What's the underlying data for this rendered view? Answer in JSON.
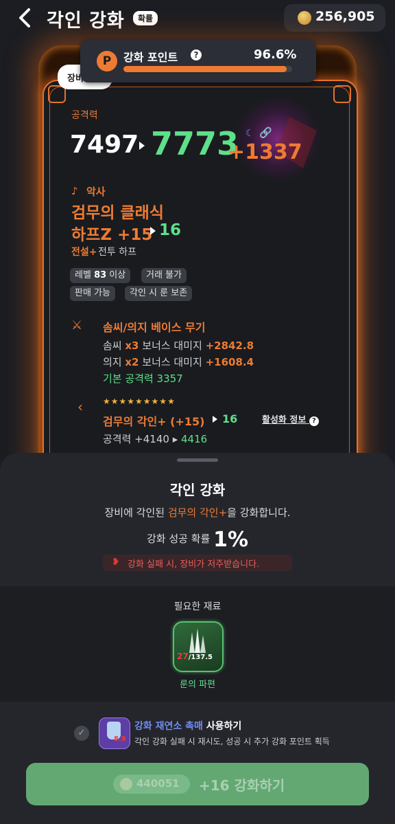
{
  "header": {
    "title": "각인 강화",
    "probability_badge": "확률",
    "coin_balance": "256,905",
    "icons": {
      "back": "back-chevron-icon",
      "coin": "coin-icon"
    }
  },
  "points_popup": {
    "icon_letter": "P",
    "label": "강화 포인트",
    "percent_text": "96.6%",
    "progress": 0.966
  },
  "card": {
    "tab_label": "장비",
    "attack_label": "공격력",
    "attack_old": "7497",
    "attack_new": "7773",
    "attack_bonus": "+1337",
    "class_label": "악사",
    "item_name_line1": "검무의 클래식",
    "item_name_line2": "하프Z +15",
    "item_new_level": "16",
    "grade": "전설+",
    "item_type": "전투 하프",
    "chips": [
      {
        "pre": "레벨 ",
        "bold": "83",
        "post": " 이상"
      },
      {
        "pre": "거래 불가",
        "bold": "",
        "post": ""
      },
      {
        "pre": "판매 가능",
        "bold": "",
        "post": ""
      },
      {
        "pre": "각인 시 룬 보존",
        "bold": "",
        "post": ""
      }
    ],
    "base_weapon_title": "솜씨/의지 베이스 무기",
    "stats": [
      {
        "pre": "솜씨 ",
        "mult": "x3",
        "mid": " 보너스 대미지 ",
        "value": "+2842.8"
      },
      {
        "pre": "의지 ",
        "mult": "x2",
        "mid": " 보너스 대미지 ",
        "value": "+1608.4"
      }
    ],
    "base_attack": "기본 공격력 3357",
    "rune": {
      "stars": "★★★★★★★★★",
      "name": "검무의 각인+ (+15)",
      "new_level": "16",
      "activation_info": "활성화 정보",
      "attack_pre": "공격력 +4140",
      "attack_new": "4416"
    }
  },
  "sheet": {
    "title": "각인 강화",
    "desc_pre": "장비에 각인된 ",
    "desc_highlight": "검무의 각인+",
    "desc_post": "을 강화합니다.",
    "success_label": "강화 성공 확률 ",
    "success_value": "1%",
    "warning": "강화 실패 시, 장비가 저주받습니다.",
    "materials_title": "필요한 재료",
    "material": {
      "have": "27",
      "need": "/137.5",
      "name": "룬의 파편"
    },
    "catalyst": {
      "name_highlight": "강화 재연소 촉매",
      "name_post": " 사용하기",
      "desc": "각인 강화 실패 시 재시도, 성공 시 추가 강화 포인트 획득",
      "count": "8.9"
    },
    "button": {
      "cost": "440051",
      "label": "+16 강화하기"
    }
  }
}
